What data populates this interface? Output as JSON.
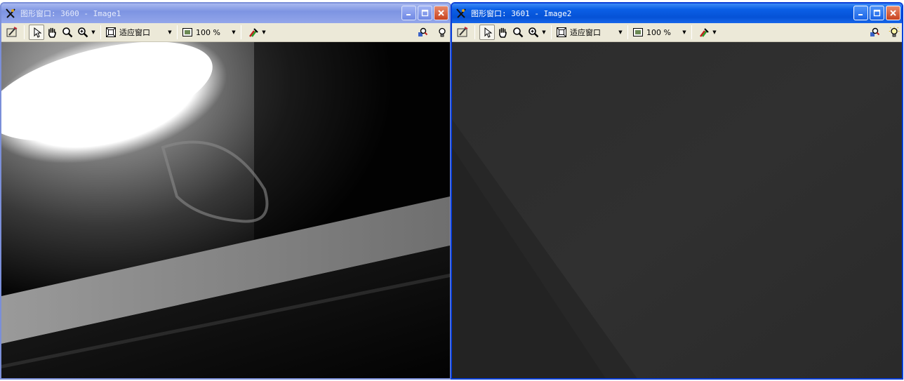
{
  "windows": [
    {
      "id": "image1",
      "title": "图形窗口: 3600 - Image1",
      "state": "inactive",
      "toolbar": {
        "fit_label": "适应窗口",
        "zoom_label": "100 %"
      }
    },
    {
      "id": "image2",
      "title": "图形窗口: 3601 - Image2",
      "state": "active",
      "toolbar": {
        "fit_label": "适应窗口",
        "zoom_label": "100 %"
      }
    }
  ],
  "icons": {
    "app": "halcon-window-icon",
    "tools": [
      "edit-icon",
      "pointer-icon",
      "pan-hand-icon",
      "zoom-icon",
      "zoom-plus-icon",
      "fit-window-icon",
      "zoom-percent-icon",
      "color-pick-icon",
      "inspect-icon",
      "bulb-icon"
    ],
    "title_buttons": [
      "minimize-icon",
      "maximize-icon",
      "close-icon"
    ]
  },
  "colors": {
    "active_border": "#0a3fd8",
    "inactive_border": "#7b8fd9",
    "toolbar_bg": "#ece9d8",
    "close_button": "#c8431f"
  }
}
